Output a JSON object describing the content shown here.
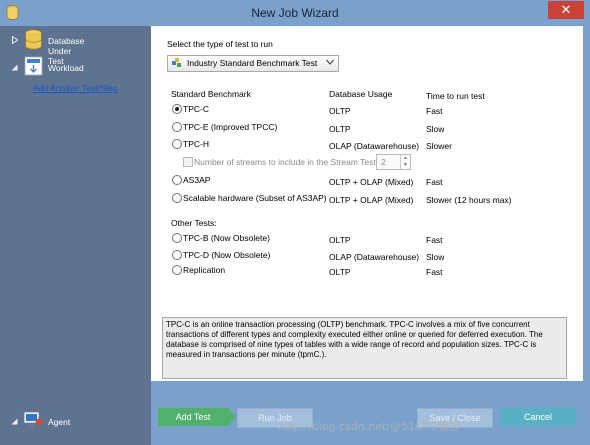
{
  "window": {
    "title": "New Job Wizard",
    "close_glyph": "✕"
  },
  "sidebar": {
    "items": [
      {
        "label": "Database Under Test",
        "icon": "database-icon"
      },
      {
        "label": "Workload",
        "icon": "workload-icon"
      },
      {
        "label": "Agent",
        "icon": "agent-icon"
      }
    ],
    "add_link": "Add Another Test/Step"
  },
  "main": {
    "select_label": "Select the type of test to run",
    "select_value": "Industry Standard Benchmark Test",
    "columns": [
      "Standard Benchmark",
      "Database Usage",
      "Time to run test"
    ],
    "benchmarks": [
      {
        "label": "TPC-C",
        "usage": "OLTP",
        "time": "Fast",
        "selected": true
      },
      {
        "label": "TPC-E (Improved TPCC)",
        "usage": "OLTP",
        "time": "Slow",
        "selected": false
      },
      {
        "label": "TPC-H",
        "usage": "OLAP (Datawarehouse)",
        "time": "Slower",
        "selected": false
      },
      {
        "label": "AS3AP",
        "usage": "OLTP + OLAP (Mixed)",
        "time": "Fast",
        "selected": false
      },
      {
        "label": "Scalable hardware (Subset of AS3AP)",
        "usage": "OLTP + OLAP (Mixed)",
        "time": "Slower (12 hours max)",
        "selected": false
      }
    ],
    "streams": {
      "label": "Number of streams to include in the Stream Test:",
      "value": "2"
    },
    "other_tests_label": "Other Tests:",
    "other_tests": [
      {
        "label": "TPC-B (Now Obsolete)",
        "usage": "OLTP",
        "time": "Fast"
      },
      {
        "label": "TPC-D (Now Obsolete)",
        "usage": "OLAP (Datawarehouse)",
        "time": "Slow"
      },
      {
        "label": "Replication",
        "usage": "OLTP",
        "time": "Fast"
      }
    ],
    "description": "TPC-C is an online transaction processing (OLTP) benchmark.  TPC-C involves a mix of five concurrent transactions of different types and complexity executed either online or queried for deferred execution.  The database is comprised of nine types of tables with a wide range of record and population sizes.  TPC-C is measured in transactions per minute (tpmC.)."
  },
  "footer": {
    "add_test": "Add Test",
    "run_job": "Run Job",
    "save_close": "Save / Close",
    "cancel": "Cancel"
  },
  "watermark": "http://blog.csdn.net/@51CTO博客",
  "colors": {
    "accent_green": "#4fb16b",
    "window_blue": "#7aa0cc",
    "sidebar": "#5e738f",
    "cancel": "#58b0c4"
  }
}
